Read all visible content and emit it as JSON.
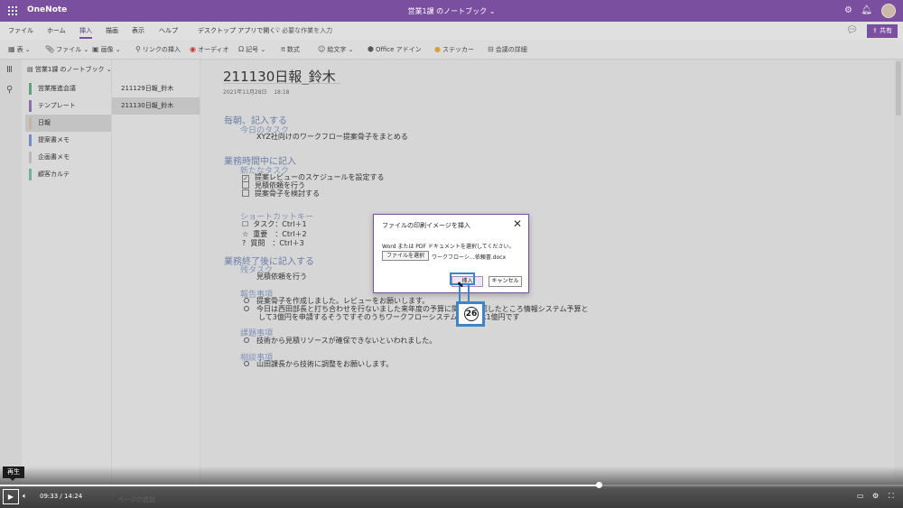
{
  "app": {
    "name": "OneNote",
    "doc_title": "営業1課 のノートブック",
    "share_label": "共有",
    "colors": {
      "brand": "#7b4fa0",
      "callout": "#3a86c8"
    }
  },
  "ribbon": {
    "tabs": [
      "ファイル",
      "ホーム",
      "挿入",
      "描画",
      "表示",
      "ヘルプ",
      "デスクトップ アプリで開く"
    ],
    "active_tab": "挿入",
    "tell_me": "必要な作業を入力",
    "tools": [
      {
        "icon": "table-icon",
        "label": "表"
      },
      {
        "icon": "file-icon",
        "label": "ファイル"
      },
      {
        "icon": "image-icon",
        "label": "画像"
      },
      {
        "icon": "link-icon",
        "label": "リンクの挿入"
      },
      {
        "icon": "audio-icon",
        "label": "オーディオ"
      },
      {
        "icon": "symbol-icon",
        "label": "記号"
      },
      {
        "icon": "equation-icon",
        "label": "数式"
      },
      {
        "icon": "emoji-icon",
        "label": "絵文字"
      },
      {
        "icon": "office-addin-icon",
        "label": "Office アドイン"
      },
      {
        "icon": "sticker-icon",
        "label": "ステッカー"
      },
      {
        "icon": "meeting-icon",
        "label": "会議の詳細"
      }
    ]
  },
  "notebook": {
    "title": "営業1課 のノートブック",
    "sections": [
      {
        "label": "営業推進会議",
        "color": "#5aa57a"
      },
      {
        "label": "テンプレート",
        "color": "#8f6bb0"
      },
      {
        "label": "日報",
        "color": "#c7b49a"
      },
      {
        "label": "提案書メモ",
        "color": "#6b8fc8"
      },
      {
        "label": "企画書メモ",
        "color": "#b9b9b9"
      },
      {
        "label": "顧客カルテ",
        "color": "#6fb68d"
      }
    ],
    "selected_section": 2,
    "pages": [
      "211129日報_鈴木",
      "211130日報_鈴木"
    ],
    "selected_page": 1
  },
  "page": {
    "title": "211130日報_鈴木",
    "date": "2021年11月28日",
    "time": "18:18",
    "morning_heading": "毎朝、記入する",
    "today_task_heading": "今日のタスク",
    "today_task": "XYZ社向けのワークフロー提案骨子をまとめる",
    "during_heading": "業務時間中に記入",
    "new_task_heading": "新たなタスク",
    "new_tasks": [
      {
        "checked": true,
        "text": "提案レビューのスケジュールを設定する"
      },
      {
        "checked": false,
        "text": "見積依頼を行う"
      },
      {
        "checked": false,
        "text": "提案骨子を検討する"
      }
    ],
    "shortcut_heading": "ショートカットキー",
    "shortcuts": [
      {
        "mark": "☐",
        "text": "タスク：Ctrl＋1"
      },
      {
        "mark": "☆",
        "text": "重要　：Ctrl＋2"
      },
      {
        "mark": "?",
        "text": "質問　：Ctrl＋3"
      }
    ],
    "after_heading": "業務終了後に記入する",
    "remaining_heading": "残タスク",
    "remaining": "見積依頼を行う",
    "report_heading": "報告事項",
    "report_items": [
      "提案骨子を作成しました。レビューをお願いします。",
      "今日は西田部長と打ち合わせを行ないました来年度の予算に関して確認したところ情報システム予算と",
      "して3億円を申請するそうですそのうちワークフローシステムの予算は1億円です"
    ],
    "issue_heading": "課題事項",
    "issue_items": [
      "技術から見積リソースが確保できないといわれました。"
    ],
    "consult_heading": "相談事項",
    "consult_items": [
      "山田課長から技術に調整をお願いします。"
    ]
  },
  "dialog": {
    "title": "ファイルの印刷イメージを挿入",
    "message": "Word または PDF ドキュメントを選択してください。",
    "choose_button": "ファイルを選択",
    "file_name": "ワークフローシ…依頼書.docx",
    "insert_button": "挿入",
    "cancel_button": "キャンセル"
  },
  "annotation": {
    "step": "26"
  },
  "player": {
    "tooltip": "再生",
    "current_time": "09:33",
    "separator": "/",
    "duration": "14:24",
    "progress": 0.663,
    "faint_text": "ページの追加"
  }
}
